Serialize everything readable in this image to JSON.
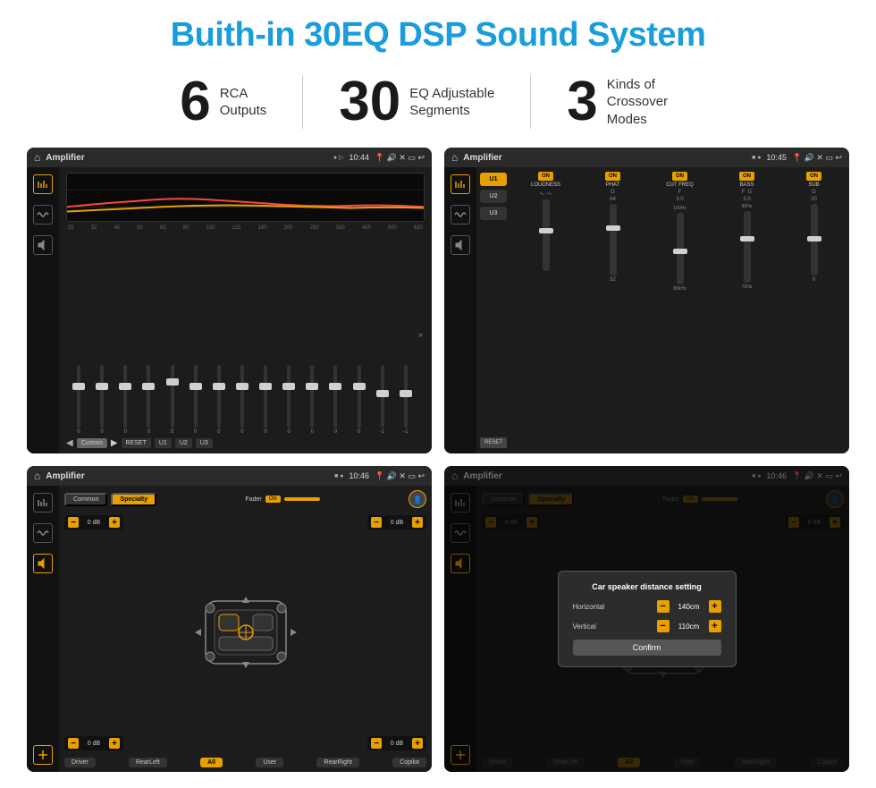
{
  "page": {
    "title": "Buith-in 30EQ DSP Sound System"
  },
  "stats": [
    {
      "number": "6",
      "label": "RCA\nOutputs"
    },
    {
      "number": "30",
      "label": "EQ Adjustable\nSegments"
    },
    {
      "number": "3",
      "label": "Kinds of\nCrossover Modes"
    }
  ],
  "screens": {
    "eq": {
      "title": "Amplifier",
      "time": "10:44",
      "freqs": [
        "25",
        "32",
        "40",
        "50",
        "63",
        "80",
        "100",
        "125",
        "160",
        "200",
        "250",
        "320",
        "400",
        "500",
        "630"
      ],
      "values": [
        "0",
        "0",
        "0",
        "0",
        "5",
        "0",
        "0",
        "0",
        "0",
        "0",
        "0",
        "0",
        "0",
        "-1",
        "0",
        "-1"
      ],
      "preset": "Custom",
      "buttons": [
        "RESET",
        "U1",
        "U2",
        "U3"
      ]
    },
    "crossover": {
      "title": "Amplifier",
      "time": "10:45",
      "presets": [
        "U1",
        "U2",
        "U3"
      ],
      "params": [
        "LOUDNESS",
        "PHAT",
        "CUT FREQ",
        "BASS",
        "SUB"
      ],
      "reset_label": "RESET"
    },
    "speaker": {
      "title": "Amplifier",
      "time": "10:46",
      "tabs": [
        "Common",
        "Specialty"
      ],
      "fader_label": "Fader",
      "fader_on": "ON",
      "volumes": [
        "0 dB",
        "0 dB",
        "0 dB",
        "0 dB"
      ],
      "buttons": [
        "Driver",
        "RearLeft",
        "All",
        "User",
        "RearRight",
        "Copilot"
      ]
    },
    "dialog": {
      "title": "Amplifier",
      "time": "10:46",
      "tabs": [
        "Common",
        "Specialty"
      ],
      "dialog_title": "Car speaker distance setting",
      "horizontal_label": "Horizontal",
      "horizontal_value": "140cm",
      "vertical_label": "Vertical",
      "vertical_value": "110cm",
      "confirm_label": "Confirm",
      "volumes": [
        "0 dB",
        "0 dB"
      ],
      "buttons": [
        "Driver",
        "RearLeft",
        "All",
        "User",
        "RearRight",
        "Copilot"
      ]
    }
  },
  "icons": {
    "home": "⌂",
    "back": "↩",
    "pin": "📍",
    "camera": "📷",
    "volume": "🔊",
    "close": "✕",
    "window": "▭",
    "eq_icon": "≡≡",
    "wave_icon": "∿∿",
    "vol_icon": "◁▷"
  }
}
